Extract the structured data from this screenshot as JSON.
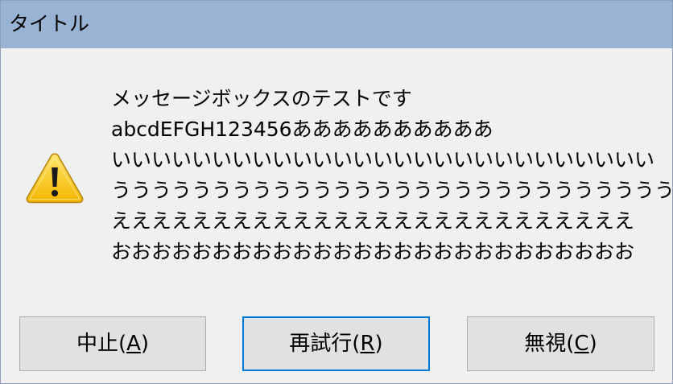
{
  "window": {
    "title": "タイトル"
  },
  "dialog": {
    "icon": "warning-icon",
    "message_lines": [
      "メッセージボックスのテストです",
      "abcdEFGH123456ああああああああああ",
      "いいいいいいいいいいいいいいいいいいいいいいいいいいい",
      "うううううううううううううううううううううううううううう",
      "ええええええええええええええええええええええええええ",
      "おおおおおおおおおおおおおおおおおおおおおおおおおお"
    ]
  },
  "buttons": {
    "abort": {
      "prefix": "中止(",
      "mnemonic": "A",
      "suffix": ")"
    },
    "retry": {
      "prefix": "再試行(",
      "mnemonic": "R",
      "suffix": ")"
    },
    "ignore": {
      "prefix": "無視(",
      "mnemonic": "C",
      "suffix": ")"
    }
  },
  "colors": {
    "titlebar": "#98b3d3",
    "background": "#f0f0f0",
    "button_face": "#e1e1e1",
    "focus_border": "#0078d7",
    "warning_fill": "#f5c518"
  }
}
